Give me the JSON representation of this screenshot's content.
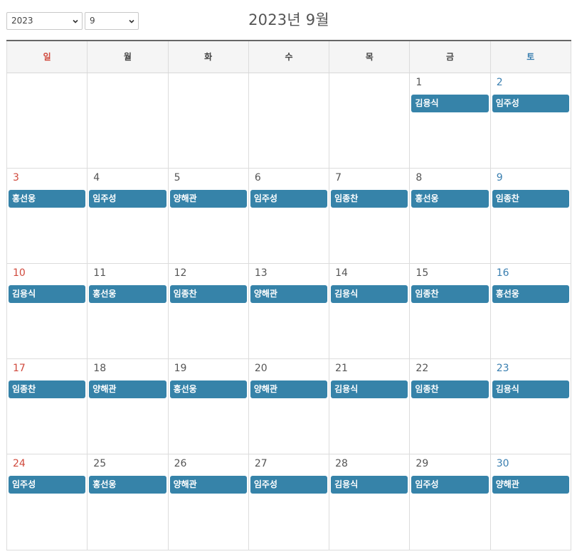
{
  "controls": {
    "year_selected": "2023",
    "month_selected": "9"
  },
  "title": "2023년 9월",
  "weekdays": [
    "일",
    "월",
    "화",
    "수",
    "목",
    "금",
    "토"
  ],
  "colors": {
    "sunday": "#d04a3d",
    "saturday": "#3a7fb0",
    "event": "#3683a9"
  },
  "weeks": [
    [
      {
        "day": "",
        "event": ""
      },
      {
        "day": "",
        "event": ""
      },
      {
        "day": "",
        "event": ""
      },
      {
        "day": "",
        "event": ""
      },
      {
        "day": "",
        "event": ""
      },
      {
        "day": "1",
        "event": "김용식"
      },
      {
        "day": "2",
        "event": "임주성"
      }
    ],
    [
      {
        "day": "3",
        "event": "홍선웅"
      },
      {
        "day": "4",
        "event": "임주성"
      },
      {
        "day": "5",
        "event": "양해관"
      },
      {
        "day": "6",
        "event": "임주성"
      },
      {
        "day": "7",
        "event": "임종찬"
      },
      {
        "day": "8",
        "event": "홍선웅"
      },
      {
        "day": "9",
        "event": "임종찬"
      }
    ],
    [
      {
        "day": "10",
        "event": "김용식"
      },
      {
        "day": "11",
        "event": "홍선웅"
      },
      {
        "day": "12",
        "event": "임종찬"
      },
      {
        "day": "13",
        "event": "양해관"
      },
      {
        "day": "14",
        "event": "김용식"
      },
      {
        "day": "15",
        "event": "임종찬"
      },
      {
        "day": "16",
        "event": "홍선웅"
      }
    ],
    [
      {
        "day": "17",
        "event": "임종찬"
      },
      {
        "day": "18",
        "event": "양해관"
      },
      {
        "day": "19",
        "event": "홍선웅"
      },
      {
        "day": "20",
        "event": "양해관"
      },
      {
        "day": "21",
        "event": "김용식"
      },
      {
        "day": "22",
        "event": "임종찬"
      },
      {
        "day": "23",
        "event": "김용식"
      }
    ],
    [
      {
        "day": "24",
        "event": "임주성"
      },
      {
        "day": "25",
        "event": "홍선웅"
      },
      {
        "day": "26",
        "event": "양해관"
      },
      {
        "day": "27",
        "event": "임주성"
      },
      {
        "day": "28",
        "event": "김용식"
      },
      {
        "day": "29",
        "event": "임주성"
      },
      {
        "day": "30",
        "event": "양해관"
      }
    ]
  ]
}
